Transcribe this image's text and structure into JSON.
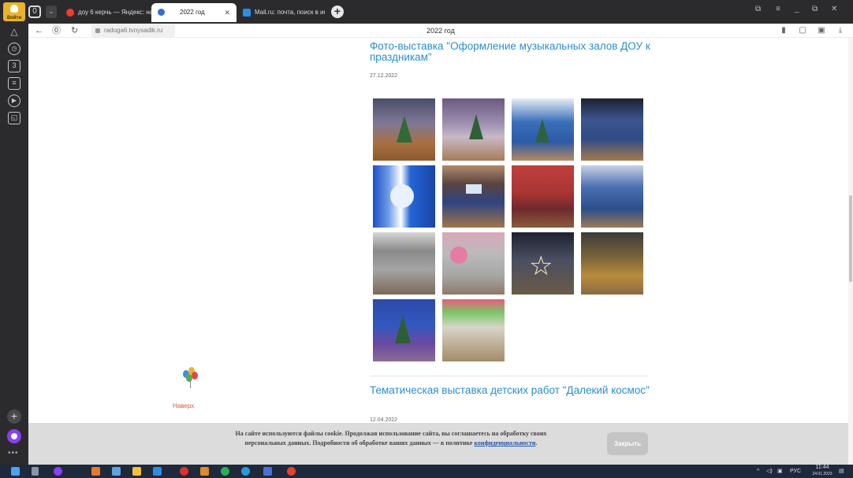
{
  "browser": {
    "badge_label": "Войти",
    "tabs_count": "0",
    "tabs": [
      {
        "label": "доу 6 керчь — Яндекс: на"
      },
      {
        "label": "2022 год"
      },
      {
        "label": "Mail.ru: почта, поиск в ин"
      }
    ],
    "address": "raduga6.tvoysadik.ru",
    "page_title": "2022 год"
  },
  "posts": [
    {
      "title": "Фото-выставка \"Оформление музыкальных залов ДОУ к праздникам\"",
      "date": "27.12.2022"
    },
    {
      "title": "Тематическая выставка детских работ \"Далекий космос\"",
      "date": "12.04.2022"
    }
  ],
  "up_link": "Наверх",
  "cookie": {
    "text_1": "На сайте используются файлы cookie. Продолжая использование сайта, вы соглашаетесь на обработку своих персональных данных. Подробности об обработке ваших данных — в политике ",
    "link": "конфиденциальности",
    "text_2": ".",
    "button": "Закрыть"
  },
  "taskbar": {
    "lang": "РУС",
    "time": "11:44",
    "date": "24.01.2023"
  },
  "colors": {
    "link_blue": "#2a8fd0",
    "up_orange": "#d9573c",
    "chrome_dark": "#2b2b2e",
    "cookie_gray": "#dcdcdc"
  }
}
